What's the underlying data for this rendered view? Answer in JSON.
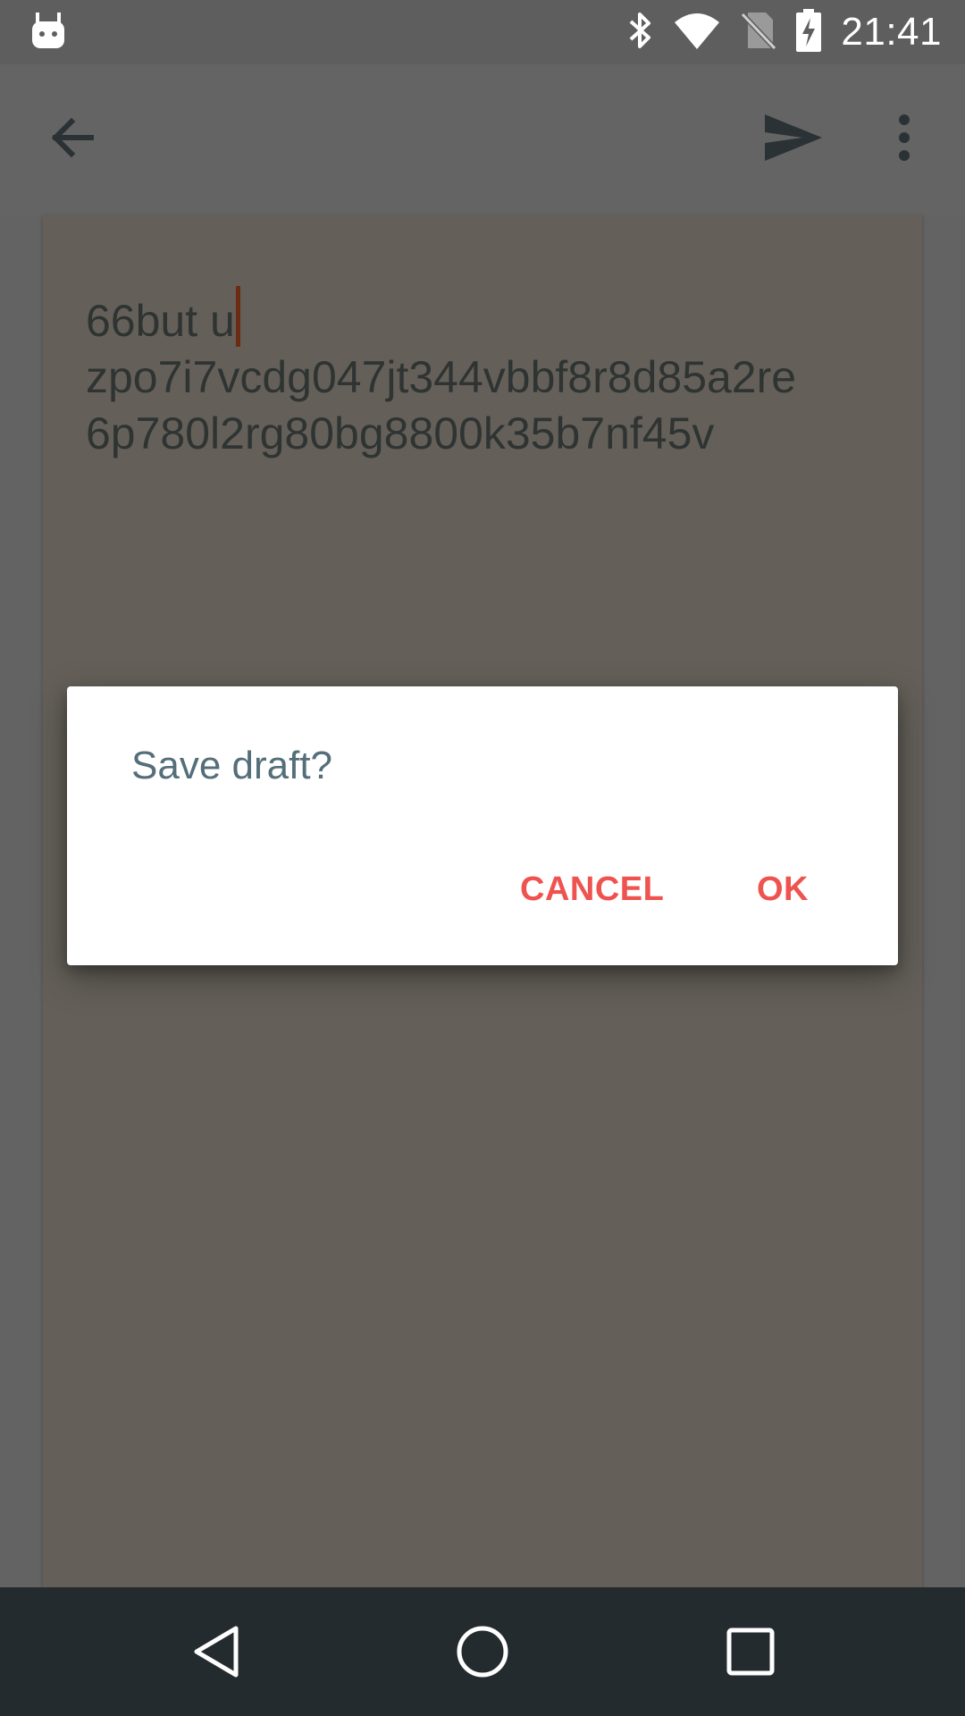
{
  "status_bar": {
    "time": "21:41",
    "icons": [
      "android-debug-icon",
      "bluetooth-icon",
      "wifi-icon",
      "no-sim-icon",
      "battery-charging-icon"
    ]
  },
  "app_bar": {
    "icons": [
      "back-arrow-icon",
      "send-icon",
      "overflow-menu-icon"
    ]
  },
  "compose": {
    "lines": [
      "66but u",
      "zpo7i7vcdg047jt344vbbf8r8d85a2re",
      "6p780l2rg80bg8800k35b7nf45v"
    ]
  },
  "dialog": {
    "title": "Save draft?",
    "cancel_label": "CANCEL",
    "ok_label": "OK"
  },
  "nav_bar": {
    "icons": [
      "back-triangle-icon",
      "home-circle-icon",
      "recents-square-icon"
    ]
  },
  "colors": {
    "accent": "#ef5350",
    "dialog_title": "#546e7a",
    "nav_bar": "#242b2f",
    "scrim_card": "#646059"
  }
}
